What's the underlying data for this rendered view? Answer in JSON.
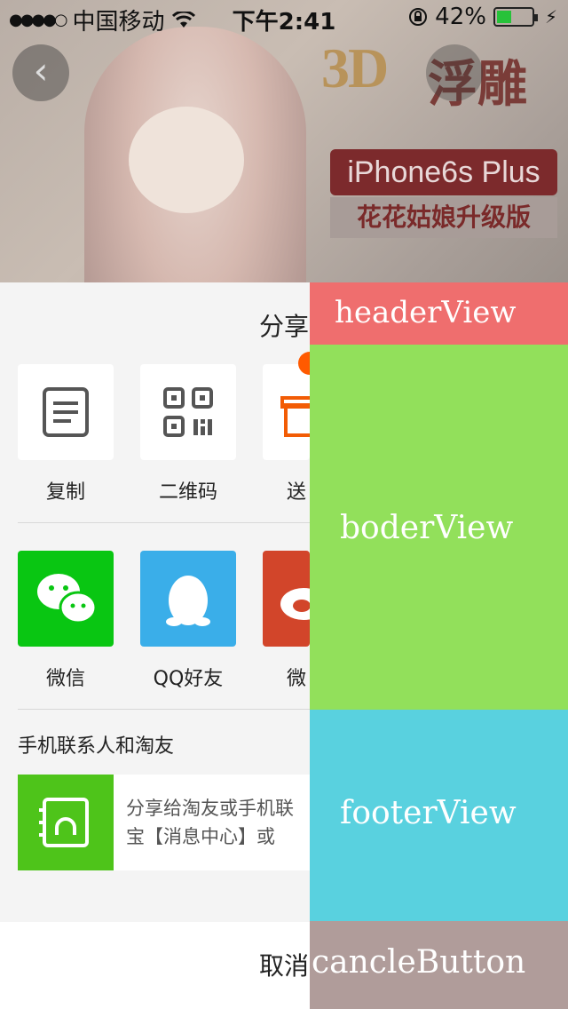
{
  "status_bar": {
    "carrier": "中国移动",
    "time": "下午2:41",
    "battery": "42%",
    "battery_level": 0.42,
    "icons": [
      "signal-dots-icon",
      "wifi-icon",
      "rotation-lock-icon",
      "battery-icon",
      "charging-icon"
    ]
  },
  "background": {
    "banner_3d": "3D",
    "banner_fudiao": "浮雕",
    "banner_model": "iPhone6s Plus",
    "banner_edition": "花花姑娘升级版"
  },
  "share_sheet": {
    "title": "分享",
    "actions": [
      {
        "label": "复制",
        "icon": "copy-document-icon"
      },
      {
        "label": "二维码",
        "icon": "qr-code-icon"
      },
      {
        "label": "送",
        "icon": "gift-icon"
      }
    ],
    "apps": [
      {
        "label": "微信",
        "icon": "wechat-icon",
        "color": "#09c612"
      },
      {
        "label": "QQ好友",
        "icon": "qq-penguin-icon",
        "color": "#3aaee9"
      },
      {
        "label": "微",
        "icon": "weibo-icon",
        "color": "#d2452a"
      }
    ],
    "contacts_title": "手机联系人和淘友",
    "contact_item": {
      "line1": "分享给淘友或手机联",
      "line2": "宝【消息中心】或",
      "icon": "contacts-book-icon",
      "color": "#4ec41a"
    },
    "cancel": "取消"
  },
  "overlay": {
    "header": "headerView",
    "boder": "boderView",
    "footer": "footerView",
    "cancle": "cancleButton",
    "colors": {
      "header": "#ef6e6e",
      "boder": "#92e05b",
      "footer": "#59d1df",
      "cancle": "#b09c9a"
    }
  }
}
